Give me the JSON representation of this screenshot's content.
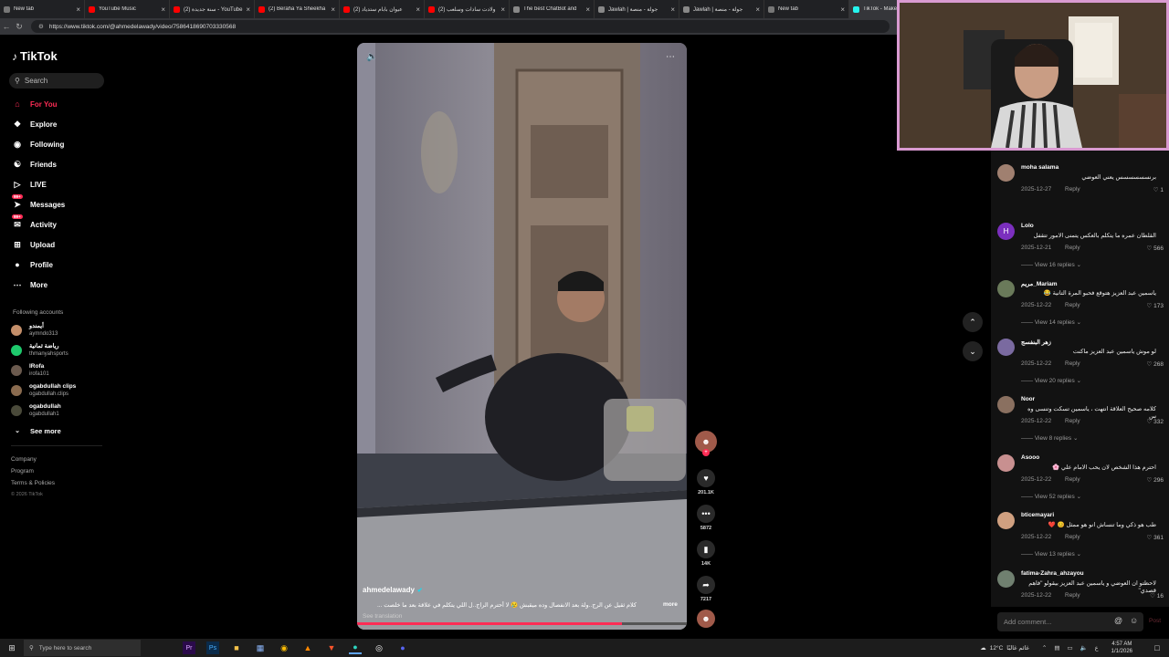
{
  "browser": {
    "tabs": [
      {
        "label": "New tab",
        "color": "#777"
      },
      {
        "label": "YouTube Music",
        "color": "#ff0000"
      },
      {
        "label": "(2) سنة جديدة - YouTube",
        "color": "#ff0000"
      },
      {
        "label": "(2) Beraha Ya Sheekha",
        "color": "#ff0000"
      },
      {
        "label": "(2) عيوان بابام ستدياد",
        "color": "#ff0000"
      },
      {
        "label": "(2) ولادت سادات وسلعب",
        "color": "#ff0000"
      },
      {
        "label": "The best ChatBot and",
        "color": "#888"
      },
      {
        "label": "Jawlah | جولة - منصة",
        "color": "#888"
      },
      {
        "label": "Jawlah | جولة - منصة",
        "color": "#888"
      },
      {
        "label": "New tab",
        "color": "#777"
      },
      {
        "label": "TikTok - Make Yo",
        "color": "#25f4ee"
      }
    ],
    "url": "https://www.tiktok.com/@ahmedelawady/video/7586418690703330568"
  },
  "tiktok": {
    "brand": "TikTok",
    "search_placeholder": "Search",
    "nav": [
      {
        "label": "For You",
        "icon": "home-icon",
        "active": true
      },
      {
        "label": "Explore",
        "icon": "compass-icon"
      },
      {
        "label": "Following",
        "icon": "following-icon"
      },
      {
        "label": "Friends",
        "icon": "friends-icon"
      },
      {
        "label": "LIVE",
        "icon": "live-icon"
      },
      {
        "label": "Messages",
        "icon": "messages-icon",
        "badge": "99+"
      },
      {
        "label": "Activity",
        "icon": "activity-icon",
        "badge": "99+"
      },
      {
        "label": "Upload",
        "icon": "upload-icon"
      },
      {
        "label": "Profile",
        "icon": "profile-icon"
      },
      {
        "label": "More",
        "icon": "more-icon"
      }
    ],
    "following_title": "Following accounts",
    "accounts": [
      {
        "name": "أيمندو",
        "handle": "aymndo313",
        "color": "#c48f6a"
      },
      {
        "name": "رياضة ثمانية",
        "handle": "thmanyahsports",
        "color": "#1ec96c"
      },
      {
        "name": "IRofa",
        "handle": "irofa101",
        "color": "#6b5a4e"
      },
      {
        "name": "ogabdullah clips",
        "handle": "ogabdullah.clips",
        "color": "#8a6b4f"
      },
      {
        "name": "ogabdullah",
        "handle": "ogabdullah1",
        "color": "#4a4a3a"
      }
    ],
    "see_more": "See more",
    "footer": [
      "Company",
      "Program",
      "Terms & Policies"
    ],
    "copyright": "© 2026 TikTok",
    "accent": "#fe2c55"
  },
  "video": {
    "author": "ahmedelawady",
    "caption": "كلام ثقيل عن الرج..ولة بعد الانفصال وده ميقبش 😢 لا أحترم الراج..ل اللي يتكلم في علاقة بعد ما خلصت ...",
    "more": "more",
    "see_translation": "See translation",
    "likes": "201.1K",
    "comments_count": "5872",
    "saves": "14K",
    "shares": "7217",
    "progress": 0.8
  },
  "comments": [
    {
      "name": "moha salama",
      "text": "برنسسسسسس يعني العوضي",
      "date": "2025-12-27",
      "likes": "1",
      "replies": "",
      "color": "#a08070"
    },
    {
      "name": "Lolo",
      "text": "القلطان عمره ما يتكلم بالعكس يتمنى الامور تتقفل",
      "date": "2025-12-21",
      "likes": "566",
      "replies": "View 16 replies",
      "color": "#7b2fbe",
      "initial": "H"
    },
    {
      "name": "مريم_Mariam",
      "text": "ياسمين عبد العزيز هتوقع فحبو المرة التانية 😂",
      "date": "2025-12-22",
      "likes": "173",
      "replies": "View 14 replies",
      "color": "#6a7a5a"
    },
    {
      "name": "زهر البنفسج",
      "text": "لو موش ياسمين عبد العزيز ماكنت",
      "date": "2025-12-22",
      "likes": "268",
      "replies": "View 20 replies",
      "color": "#7a6aa0"
    },
    {
      "name": "Noor",
      "text": "كلامه صحيح العلاقة انتهت ، ياسمين تسكت وتنسى وه س",
      "date": "2025-12-22",
      "likes": "332",
      "replies": "View 8 replies",
      "color": "#8a7060"
    },
    {
      "name": "Asooo",
      "text": "احترم هذا الشخص لان يحب الامام علي 🌸",
      "date": "2025-12-22",
      "likes": "296",
      "replies": "View 52 replies",
      "color": "#c89090"
    },
    {
      "name": "bticemayari",
      "text": "طب هو ذكي وما تنساش انو هو ممثل 😊 ❤️",
      "date": "2025-12-22",
      "likes": "361",
      "replies": "View 13 replies",
      "color": "#d0a080"
    },
    {
      "name": "fatima-Zahra_ahzayou",
      "text": "لاحظتو ان العوضي و ياسمين عبد العزيز بيقولو \"فاهم قصدي\"",
      "date": "2025-12-22",
      "likes": "16",
      "replies": "",
      "color": "#708070"
    }
  ],
  "comment_reply": "Reply",
  "add_comment": "Add comment...",
  "post_label": "Post",
  "taskbar": {
    "search_placeholder": "Type here to search",
    "weather": "12°C",
    "weather_desc": "غائم غالبًا",
    "time": "4:57 AM",
    "date": "1/1/2026",
    "lang": "ع"
  }
}
